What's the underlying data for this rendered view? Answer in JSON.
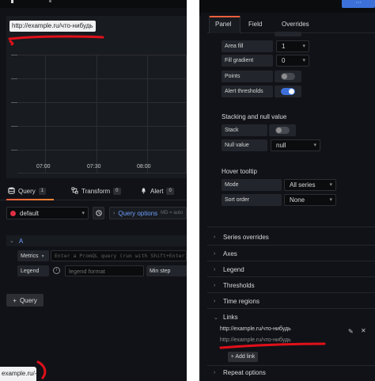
{
  "query_editor": {
    "chart_title": "http://example.ru/что-нибудь",
    "time_labels": [
      "07:00",
      "07:30",
      "08:00"
    ],
    "tabs": [
      {
        "label": "Query",
        "count": "1"
      },
      {
        "label": "Transform",
        "count": "0"
      },
      {
        "label": "Alert",
        "count": "0"
      }
    ],
    "datasource": "default",
    "query_options_label": "Query options",
    "query_options_meta": "MD = auto",
    "query_letter": "A",
    "metrics_label": "Metrics",
    "metrics_placeholder": "Enter a PromQL query (run with Shift+Enter)",
    "legend_label": "Legend",
    "legend_placeholder": "legend format",
    "min_step_label": "Min step",
    "add_query_label": "Query",
    "status_url": "example.ru/-"
  },
  "options_pane": {
    "tabs": [
      "Panel",
      "Field",
      "Overrides"
    ],
    "active_tab": "Panel",
    "rows": [
      {
        "label": "Area fill",
        "kind": "select",
        "value": "1"
      },
      {
        "label": "Fill gradient",
        "kind": "select",
        "value": "0"
      },
      {
        "label": "Points",
        "kind": "toggle",
        "on": false
      },
      {
        "label": "Alert thresholds",
        "kind": "toggle",
        "on": true
      }
    ],
    "stacking_title": "Stacking and null value",
    "stack_label": "Stack",
    "stack_on": false,
    "null_value_label": "Null value",
    "null_value": "null",
    "hover_title": "Hover tooltip",
    "mode_label": "Mode",
    "mode_value": "All series",
    "sort_order_label": "Sort order",
    "sort_order_value": "None",
    "sections": [
      "Series overrides",
      "Axes",
      "Legend",
      "Thresholds",
      "Time regions"
    ],
    "links_title": "Links",
    "link_title": "http://example.ru/что-нибудь",
    "link_url": "http://example.ru/что-нибудь",
    "add_link_label": "Add link",
    "repeat_options_label": "Repeat options"
  },
  "colors": {
    "background": "#111217",
    "panel": "#181b1f",
    "accent_blue": "#3d71d9",
    "accent_orange": "#f55f3e",
    "annotation_red": "#e0101a"
  }
}
